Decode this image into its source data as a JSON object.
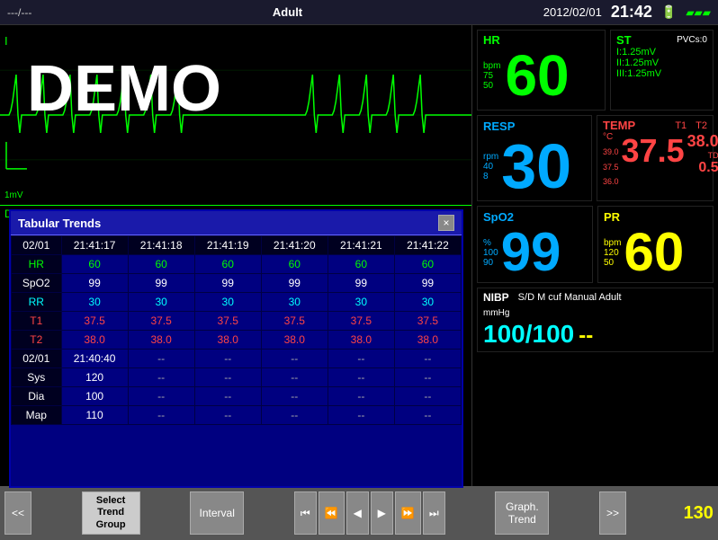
{
  "topbar": {
    "left": "---/---",
    "center": "Adult",
    "date": "2012/02/01",
    "time": "21:42",
    "battery_icon": "🔋"
  },
  "ecg": {
    "lead_label": "I",
    "demo_text": "DEMO",
    "scale_label": "1mV"
  },
  "diagnosis_label": "Diagnosis",
  "modal": {
    "title": "Tabular Trends",
    "close_label": "×",
    "columns": [
      "02/01",
      "21:41:17",
      "21:41:18",
      "21:41:19",
      "21:41:20",
      "21:41:21",
      "21:41:22"
    ],
    "rows": [
      {
        "label": "HR",
        "type": "hr",
        "values": [
          "60",
          "60",
          "60",
          "60",
          "60",
          "60"
        ]
      },
      {
        "label": "SpO2",
        "type": "spo2",
        "values": [
          "99",
          "99",
          "99",
          "99",
          "99",
          "99"
        ]
      },
      {
        "label": "RR",
        "type": "rr",
        "values": [
          "30",
          "30",
          "30",
          "30",
          "30",
          "30"
        ]
      },
      {
        "label": "T1",
        "type": "t1",
        "values": [
          "37.5",
          "37.5",
          "37.5",
          "37.5",
          "37.5",
          "37.5"
        ]
      },
      {
        "label": "T2",
        "type": "t2",
        "values": [
          "38.0",
          "38.0",
          "38.0",
          "38.0",
          "38.0",
          "38.0"
        ]
      },
      {
        "label": "02/01",
        "type": "date",
        "values": [
          "21:40:40",
          "--",
          "--",
          "--",
          "--",
          "--"
        ]
      },
      {
        "label": "Sys",
        "type": "sys",
        "values": [
          "120",
          "--",
          "--",
          "--",
          "--",
          "--"
        ]
      },
      {
        "label": "Dia",
        "type": "dia",
        "values": [
          "100",
          "--",
          "--",
          "--",
          "--",
          "--"
        ]
      },
      {
        "label": "Map",
        "type": "map",
        "values": [
          "110",
          "--",
          "--",
          "--",
          "--",
          "--"
        ]
      }
    ]
  },
  "vitals": {
    "hr": {
      "title": "HR",
      "unit": "bpm",
      "scale_high": "75",
      "scale_low": "50",
      "value": "60",
      "st_title": "ST",
      "pvc": "PVCs:0",
      "st_rows": [
        "I:1.25mV",
        "II:1.25mV",
        "III:1.25mV"
      ]
    },
    "resp": {
      "title": "RESP",
      "unit": "rpm",
      "scale_high": "40",
      "scale_low": "8",
      "value": "30"
    },
    "temp": {
      "title": "TEMP",
      "t1_label": "T1",
      "t2_label": "T2",
      "unit": "°C",
      "scale_high": "39.0",
      "scale_mid": "37.5",
      "scale_low": "36.0",
      "value": "37.5",
      "td_label": "TD",
      "td_value": "0.5",
      "t2_value": "38.0"
    },
    "spo2": {
      "title": "SpO2",
      "unit": "%",
      "scale_high": "100",
      "scale_low": "90",
      "value": "99"
    },
    "pr": {
      "title": "PR",
      "unit": "bpm",
      "scale_high": "120",
      "scale_low": "50",
      "value": "60"
    },
    "nibp": {
      "title": "NIBP",
      "info": "S/D M cuf Manual Adult",
      "unit": "mmHg",
      "value": "100/100",
      "dash_value": "--"
    }
  },
  "bottom_bar": {
    "prev_label": "<<",
    "select_trend_label": "Select\nTrend\nGroup",
    "interval_label": "Interval",
    "nav_first": "⏮",
    "nav_prev_fast": "⏪",
    "nav_prev": "◀",
    "nav_next": "▶",
    "nav_next_fast": "⏩",
    "nav_last": "⏭",
    "graph_trend_label": "Graph.\nTrend",
    "next_label": ">>",
    "right_number": "130"
  }
}
